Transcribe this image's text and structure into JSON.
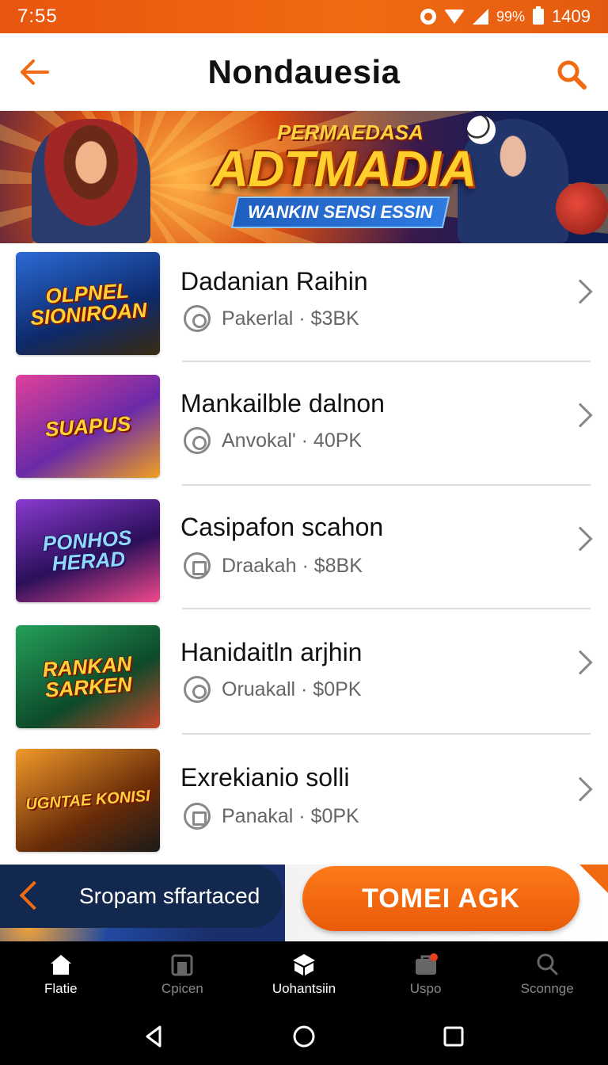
{
  "status": {
    "time": "7:55",
    "battery_pct": "99%",
    "right_time": "1409"
  },
  "header": {
    "title": "Nondauesia"
  },
  "banner": {
    "kicker": "PERMAEDASA",
    "headline": "ADTMADIA",
    "sub": "WANKIN SENSI ESSIN"
  },
  "items": [
    {
      "title": "Dadanian Raihin",
      "meta": "Pakerlal · $3BK",
      "icon": "timer-icon",
      "thumb_text": "OLPNEL SIONIROAN",
      "thumb_colors": [
        "#1b4fb8",
        "#0d2a6b"
      ]
    },
    {
      "title": "Mankailble dalnon",
      "meta": "Anvokal' · 40PK",
      "icon": "timer-icon",
      "thumb_text": "SUAPUS",
      "thumb_colors": [
        "#d63aa8",
        "#5a1d8e"
      ]
    },
    {
      "title": "Casipafon scahon",
      "meta": "Draakah · $8BK",
      "icon": "calendar-icon",
      "thumb_text": "PONHOS HERAD",
      "thumb_colors": [
        "#7a2fbf",
        "#2a0f5a"
      ]
    },
    {
      "title": "Hanidaitln arjhin",
      "meta": "Oruakall · $0PK",
      "icon": "timer-icon",
      "thumb_text": "RANKAN SARKEN",
      "thumb_colors": [
        "#1e8f4a",
        "#0d4a2a"
      ]
    },
    {
      "title": "Exrekianio solli",
      "meta": "Panakal · $0PK",
      "icon": "calendar-icon",
      "thumb_text": "UGNTAE KONISI",
      "thumb_colors": [
        "#e07a18",
        "#6a2c08"
      ]
    }
  ],
  "promo": {
    "toast": "Sropam sffartaced",
    "cta": "TOMEI AGK"
  },
  "bottom_nav": [
    {
      "label": "Flatie",
      "icon": "home-icon",
      "active": true
    },
    {
      "label": "Cpicen",
      "icon": "store-icon",
      "active": false
    },
    {
      "label": "Uohantsiin",
      "icon": "box-icon",
      "active": true
    },
    {
      "label": "Uspo",
      "icon": "bag-icon",
      "active": false
    },
    {
      "label": "Sconnge",
      "icon": "search-icon",
      "active": false
    }
  ],
  "colors": {
    "accent": "#f06a12",
    "status_bar": "#e8560f"
  }
}
